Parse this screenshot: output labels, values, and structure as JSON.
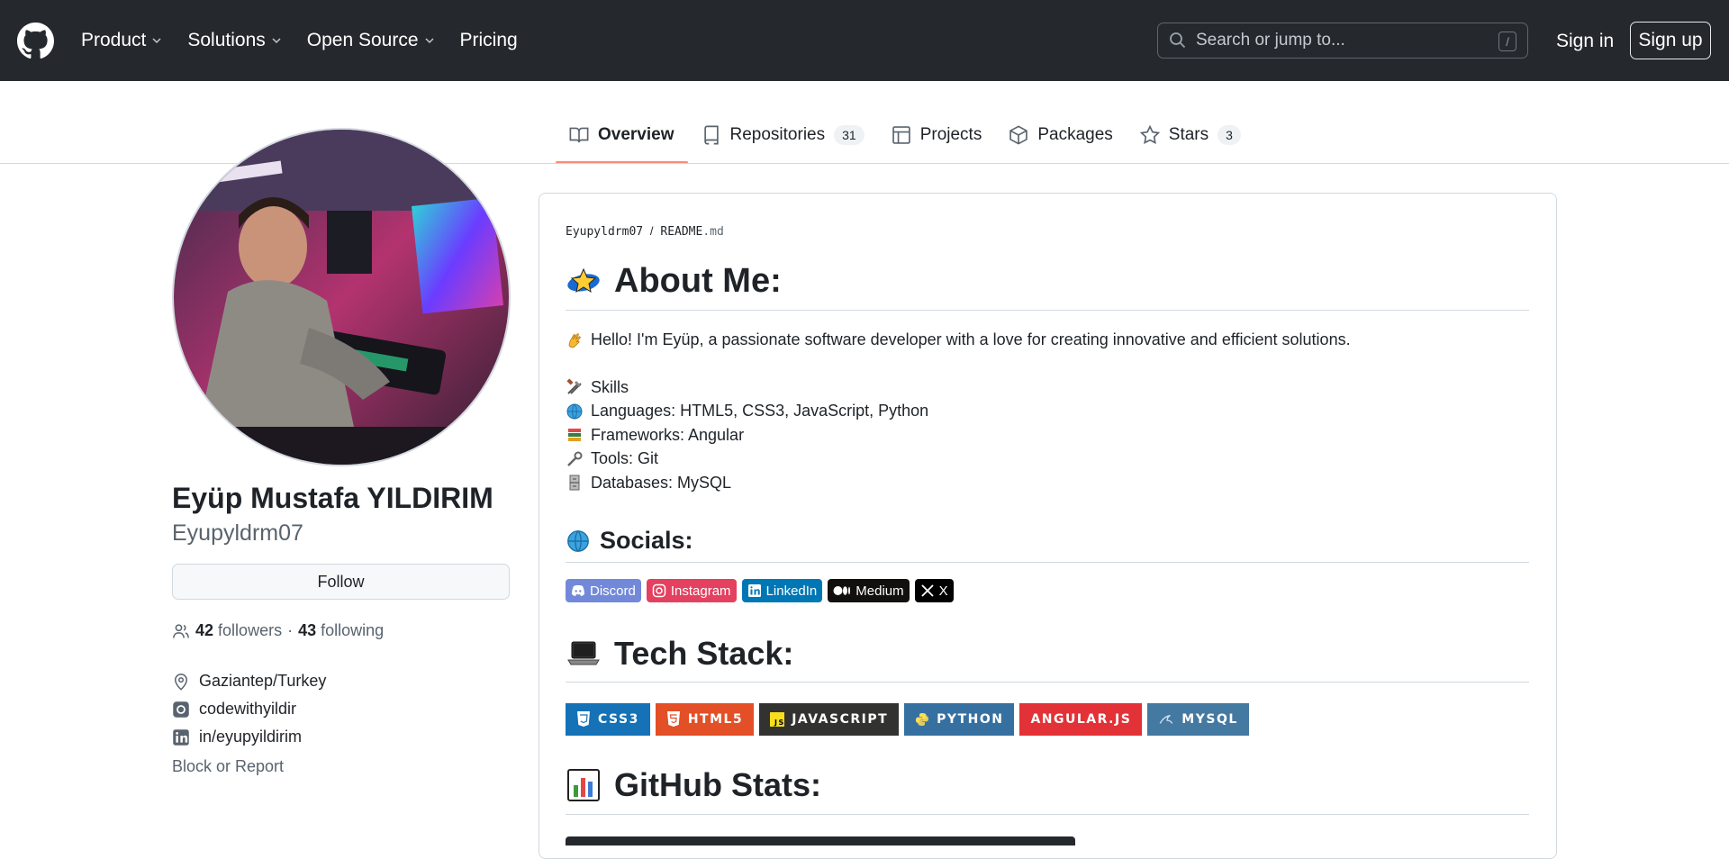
{
  "header": {
    "nav": [
      {
        "label": "Product",
        "has_dropdown": true
      },
      {
        "label": "Solutions",
        "has_dropdown": true
      },
      {
        "label": "Open Source",
        "has_dropdown": true
      },
      {
        "label": "Pricing",
        "has_dropdown": false
      }
    ],
    "search_placeholder": "Search or jump to...",
    "search_shortcut": "/",
    "sign_in": "Sign in",
    "sign_up": "Sign up"
  },
  "tabs": [
    {
      "label": "Overview",
      "icon": "book-icon",
      "active": true
    },
    {
      "label": "Repositories",
      "icon": "repo-icon",
      "count": "31"
    },
    {
      "label": "Projects",
      "icon": "table-icon"
    },
    {
      "label": "Packages",
      "icon": "package-icon"
    },
    {
      "label": "Stars",
      "icon": "star-icon",
      "count": "3"
    }
  ],
  "profile": {
    "full_name": "Eyüp Mustafa YILDIRIM",
    "username": "Eyupyldrm07",
    "follow_label": "Follow",
    "followers_count": "42",
    "followers_label": "followers",
    "separator": "·",
    "following_count": "43",
    "following_label": "following",
    "location": "Gaziantep/Turkey",
    "instagram": "codewithyildir",
    "linkedin": "in/eyupyildirim",
    "block_report": "Block or Report"
  },
  "readme": {
    "path_user": "Eyupyldrm07",
    "path_sep": "/",
    "path_file": "README",
    "path_ext": ".md",
    "about_title": "About Me:",
    "intro": "Hello! I'm Eyüp, a passionate software developer with a love for creating innovative and efficient solutions.",
    "skills": [
      {
        "emoji": "tools-icon",
        "text": "Skills"
      },
      {
        "emoji": "globe-icon",
        "text": "Languages: HTML5, CSS3, JavaScript, Python"
      },
      {
        "emoji": "books-icon",
        "text": "Frameworks: Angular"
      },
      {
        "emoji": "wrench-icon",
        "text": "Tools: Git"
      },
      {
        "emoji": "file-cabinet-icon",
        "text": "Databases: MySQL"
      }
    ],
    "socials_title": "Socials:",
    "socials": [
      {
        "label": "Discord",
        "color": "#7289da",
        "icon": "discord-icon"
      },
      {
        "label": "Instagram",
        "color": "#e4405f",
        "icon": "instagram-icon"
      },
      {
        "label": "LinkedIn",
        "color": "#0077b5",
        "icon": "linkedin-icon"
      },
      {
        "label": "Medium",
        "color": "#12100e",
        "icon": "medium-icon"
      },
      {
        "label": "X",
        "color": "#000000",
        "icon": "x-icon"
      }
    ],
    "tech_title": "Tech Stack:",
    "tech": [
      {
        "label": "CSS3",
        "color": "#1572b6",
        "icon_color": "#ffffff"
      },
      {
        "label": "HTML5",
        "color": "#e34f26",
        "icon_color": "#ffffff"
      },
      {
        "label": "JAVASCRIPT",
        "color": "#323330",
        "icon_color": "#f7df1e"
      },
      {
        "label": "PYTHON",
        "color": "#3670a0",
        "icon_color": "#ffdd54"
      },
      {
        "label": "ANGULAR.JS",
        "color": "#e23237",
        "icon_color": "#e23237"
      },
      {
        "label": "MYSQL",
        "color": "#4479a1",
        "icon_color": "#4479a1"
      }
    ],
    "stats_title": "GitHub Stats:"
  }
}
